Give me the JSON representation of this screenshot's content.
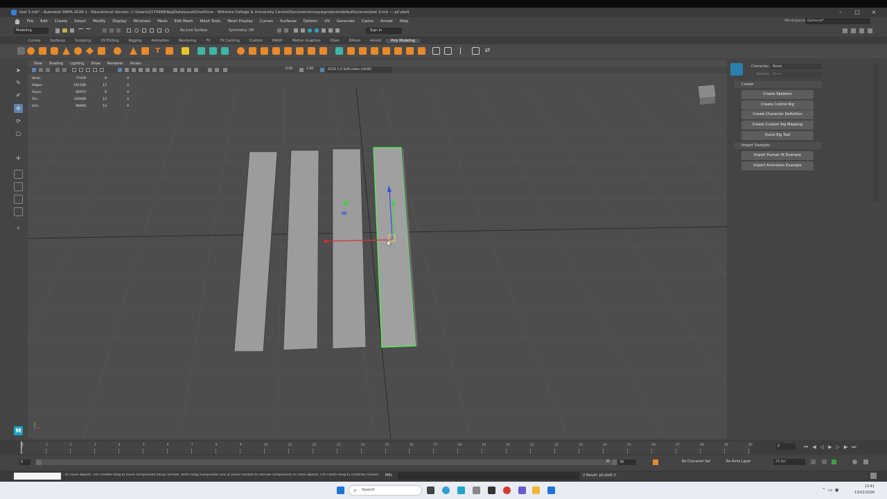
{
  "window": {
    "title": "test 3.mb* - Autodesk MAYA 2026.1 - Educational Version: C:\\Users\\2170968\\AppData\\Local\\OneDrive - Wiltshire College & University Centre\\Documents\\maya\\projects\\default\\scenes\\test 3.mb --- pCube5"
  },
  "workspace": {
    "label": "Workspace:",
    "value": "General*"
  },
  "menus": [
    "File",
    "Edit",
    "Create",
    "Select",
    "Modify",
    "Display",
    "Windows",
    "Mesh",
    "Edit Mesh",
    "Mesh Tools",
    "Mesh Display",
    "Curves",
    "Surfaces",
    "Deform",
    "UV",
    "Generate",
    "Cache",
    "Arnold",
    "Help"
  ],
  "statusline": {
    "mode": "Modeling",
    "live_surface": "No Live Surface",
    "symmetry": "Symmetry: Off",
    "sign_in": "Sign In"
  },
  "shelf_tabs": [
    "Curves",
    "Surfaces",
    "Sculpting",
    "UV Editing",
    "Rigging",
    "Animation",
    "Rendering",
    "FX",
    "FX Caching",
    "Custom",
    "MASH",
    "Motion Graphics",
    "XGen",
    "Bifrost",
    "Arnold",
    "Poly Modeling"
  ],
  "shelf_active_tab": "Poly Modeling",
  "viewport": {
    "menus": [
      "View",
      "Shading",
      "Lighting",
      "Show",
      "Renderer",
      "Panels"
    ],
    "exposure": "0.00",
    "gamma": "1.00",
    "color_space": "ACES 1.0 SDR-video (sRGB)"
  },
  "hud": [
    {
      "label": "Verts:",
      "a": "77478",
      "b": "8",
      "c": "0"
    },
    {
      "label": "Edges:",
      "a": "161186",
      "b": "12",
      "c": "0"
    },
    {
      "label": "Faces:",
      "a": "82974",
      "b": "6",
      "c": "0"
    },
    {
      "label": "Tris:",
      "a": "165948",
      "b": "12",
      "c": "0"
    },
    {
      "label": "UVs:",
      "a": "96966",
      "b": "14",
      "c": "0"
    }
  ],
  "character_panel": {
    "character_label": "Character:",
    "character_value": "None",
    "source_label": "Source:",
    "source_value": "None",
    "create_header": "Create",
    "buttons": [
      "Create Skeleton",
      "Create Control Rig",
      "Create Character Definition",
      "Create Custom Rig Mapping",
      "Quick Rig Tool"
    ],
    "import_header": "Import Samples",
    "import_buttons": [
      "Import Human IK Example",
      "Import Animation Example"
    ]
  },
  "timeline": {
    "ticks": [
      "0",
      "1",
      "2",
      "3",
      "4",
      "5",
      "6",
      "7",
      "8",
      "9",
      "10",
      "11",
      "12",
      "13",
      "14",
      "15",
      "16",
      "17",
      "18",
      "19",
      "20",
      "21",
      "22",
      "23",
      "24",
      "25",
      "26",
      "27",
      "28",
      "29",
      "30"
    ],
    "current_frame": "0"
  },
  "range": {
    "start": "0",
    "inner_start": "0",
    "inner_end": "30",
    "end": "30",
    "character_set": "No Character Set",
    "anim_layer": "No Anim Layer",
    "fps": "24 fps"
  },
  "command": {
    "help_text": "...to move objects. Ctrl+middle-drag to move components along normals. Shift+drag manipulator axis or plane handles to extrude components or clone objects. Ctrl+Shift+drag to constrain movement to a con",
    "lang": "MEL",
    "result": "// Result: pCube5 //"
  },
  "taskbar": {
    "search": "Search",
    "time": "13:41",
    "date": "13/02/2026"
  },
  "colors": {
    "selection": "#4cff4c",
    "axis_x": "#e03030",
    "axis_y": "#40d040",
    "axis_z": "#3050e0",
    "shelf_icon": "#e8892a"
  }
}
